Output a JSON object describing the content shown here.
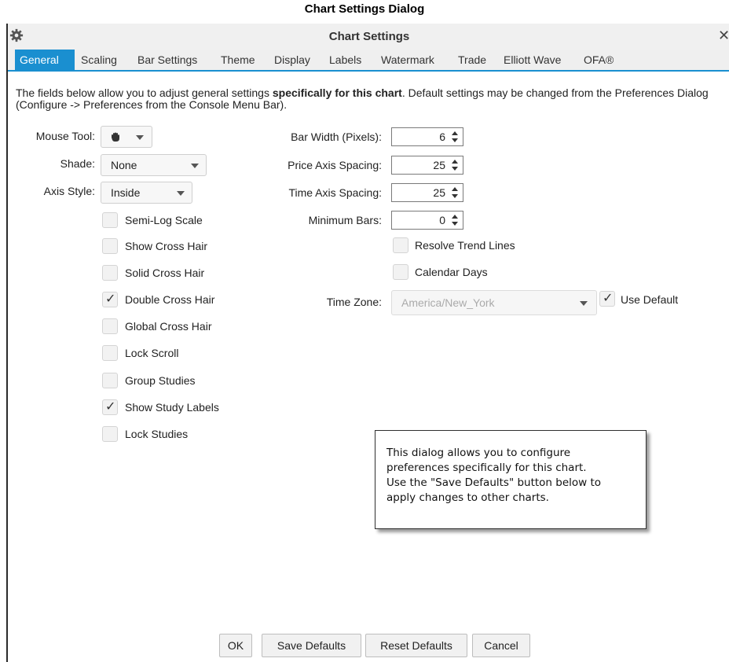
{
  "caption": "Chart Settings Dialog",
  "window": {
    "title": "Chart Settings",
    "close": "✕"
  },
  "tabs": [
    {
      "label": "General",
      "active": true
    },
    {
      "label": "Scaling"
    },
    {
      "label": "Bar Settings"
    },
    {
      "label": "Theme"
    },
    {
      "label": "Display"
    },
    {
      "label": "Labels"
    },
    {
      "label": "Watermark"
    },
    {
      "label": "Trade"
    },
    {
      "label": "Elliott Wave"
    },
    {
      "label": "OFA®"
    }
  ],
  "description": {
    "part1": "The fields below allow you to adjust general settings ",
    "bold": "specifically for this chart",
    "part2": ".  Default settings may be changed from the Preferences Dialog (Configure -> Preferences from the Console Menu Bar)."
  },
  "left_fields": {
    "mouse_tool": {
      "label": "Mouse Tool:",
      "icon": "hand-icon"
    },
    "shade": {
      "label": "Shade:",
      "value": "None"
    },
    "axis_style": {
      "label": "Axis Style:",
      "value": "Inside"
    }
  },
  "checkboxes": [
    {
      "label": "Semi-Log Scale",
      "checked": false
    },
    {
      "label": "Show Cross Hair",
      "checked": false
    },
    {
      "label": "Solid Cross Hair",
      "checked": false
    },
    {
      "label": "Double Cross Hair",
      "checked": true
    },
    {
      "label": "Global Cross Hair",
      "checked": false
    },
    {
      "label": "Lock Scroll",
      "checked": false
    },
    {
      "label": "Group Studies",
      "checked": false
    },
    {
      "label": "Show Study Labels",
      "checked": true
    },
    {
      "label": "Lock Studies",
      "checked": false
    }
  ],
  "right_fields": {
    "bar_width": {
      "label": "Bar Width (Pixels):",
      "value": "6"
    },
    "price_axis_spacing": {
      "label": "Price Axis Spacing:",
      "value": "25"
    },
    "time_axis_spacing": {
      "label": "Time Axis Spacing:",
      "value": "25"
    },
    "minimum_bars": {
      "label": "Minimum Bars:",
      "value": "0"
    },
    "resolve_trend_lines": {
      "label": "Resolve Trend Lines",
      "checked": false
    },
    "calendar_days": {
      "label": "Calendar Days",
      "checked": false
    },
    "time_zone": {
      "label": "Time Zone:",
      "value": "America/New_York",
      "use_default_label": "Use Default",
      "use_default_checked": true
    }
  },
  "tooltip": {
    "line1": "This dialog allows you to configure",
    "line2": "preferences specifically for this chart.",
    "line3": "Use the \"Save Defaults\" button below to",
    "line4": "apply changes to other charts."
  },
  "buttons": {
    "ok": "OK",
    "save_defaults": "Save Defaults",
    "reset_defaults": "Reset Defaults",
    "cancel": "Cancel"
  },
  "colors": {
    "accent": "#1a8fd0"
  }
}
